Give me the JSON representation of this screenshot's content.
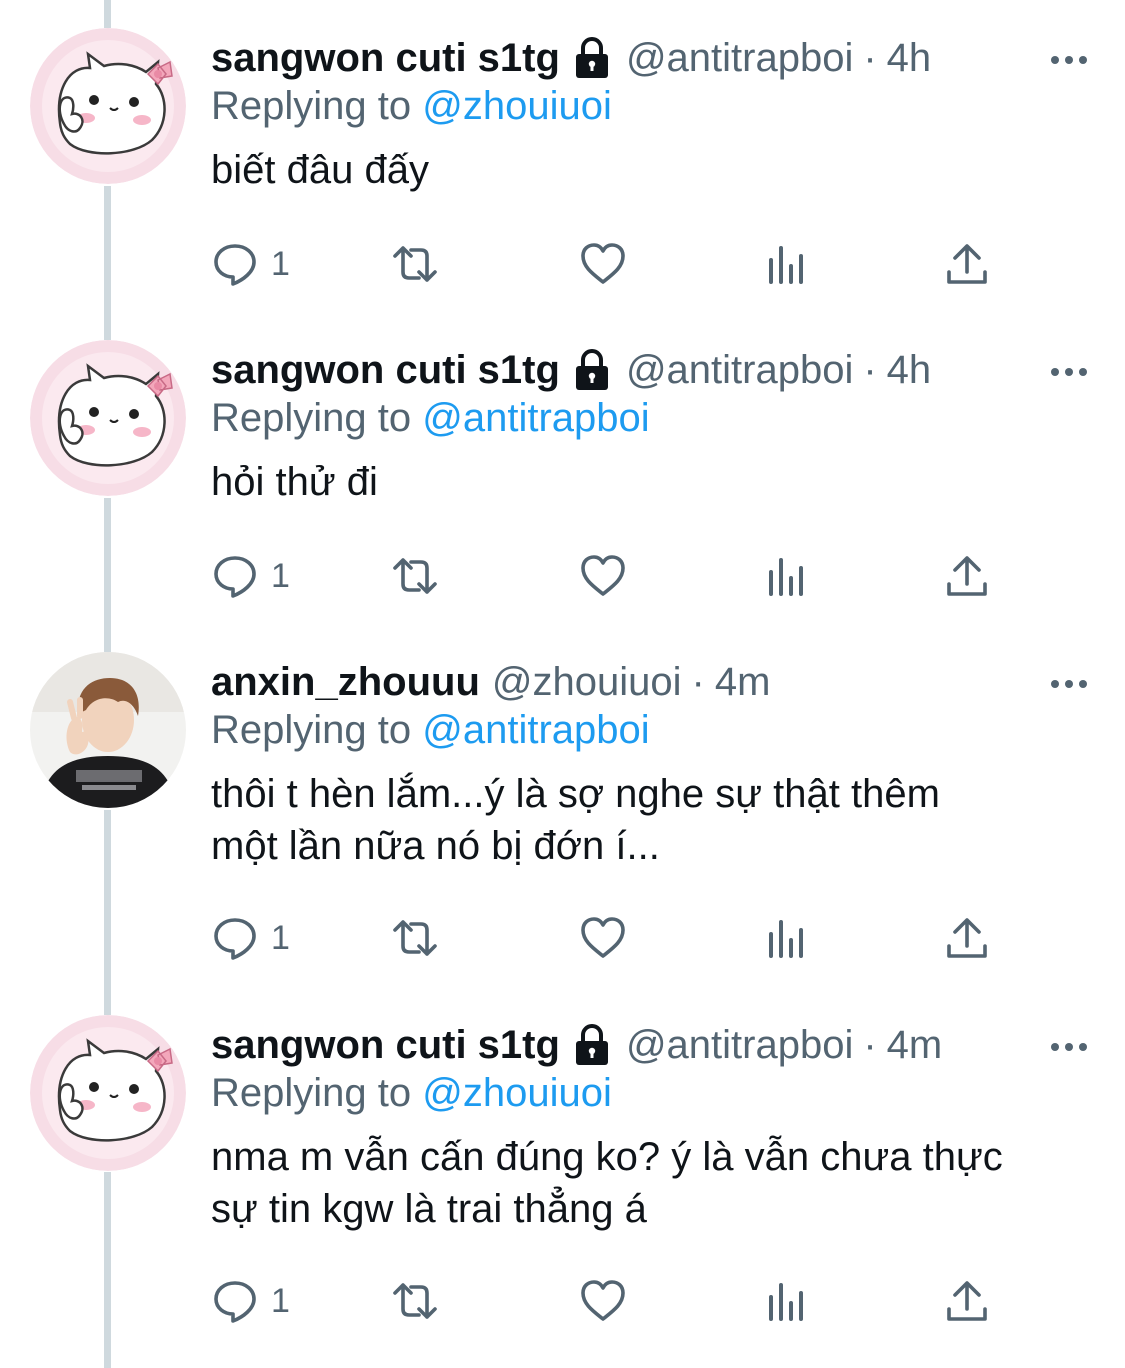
{
  "tweets": [
    {
      "name": "sangwon cuti s1tg",
      "protected": true,
      "handle": "@antitrapboi",
      "separator": "·",
      "time": "4h",
      "reply_prefix": "Replying to",
      "reply_to": "@zhouiuoi",
      "text": "biết đâu đấy",
      "reply_count": "1",
      "avatar": "hello-kitty-avatar"
    },
    {
      "name": "sangwon cuti s1tg",
      "protected": true,
      "handle": "@antitrapboi",
      "separator": "·",
      "time": "4h",
      "reply_prefix": "Replying to",
      "reply_to": "@antitrapboi",
      "text": "hỏi thử đi",
      "reply_count": "1",
      "avatar": "hello-kitty-avatar"
    },
    {
      "name": "anxin_zhouuu",
      "protected": false,
      "handle": "@zhouiuoi",
      "separator": "·",
      "time": "4m",
      "reply_prefix": "Replying to",
      "reply_to": "@antitrapboi",
      "text_lines": [
        "thôi t hèn lắm...ý là sợ nghe sự thật thêm",
        "một lần nữa nó bị đớn í..."
      ],
      "reply_count": "1",
      "avatar": "person-photo-avatar"
    },
    {
      "name": "sangwon cuti s1tg",
      "protected": true,
      "handle": "@antitrapboi",
      "separator": "·",
      "time": "4m",
      "reply_prefix": "Replying to",
      "reply_to": "@zhouiuoi",
      "text_lines": [
        "nma m vẫn cấn đúng ko? ý là vẫn chưa thực",
        "sự tin kgw là trai thẳng á"
      ],
      "reply_count": "1",
      "avatar": "hello-kitty-avatar"
    }
  ],
  "colors": {
    "link": "#1d9bf0",
    "secondary": "#536471",
    "thread_line": "#cfd9de"
  }
}
